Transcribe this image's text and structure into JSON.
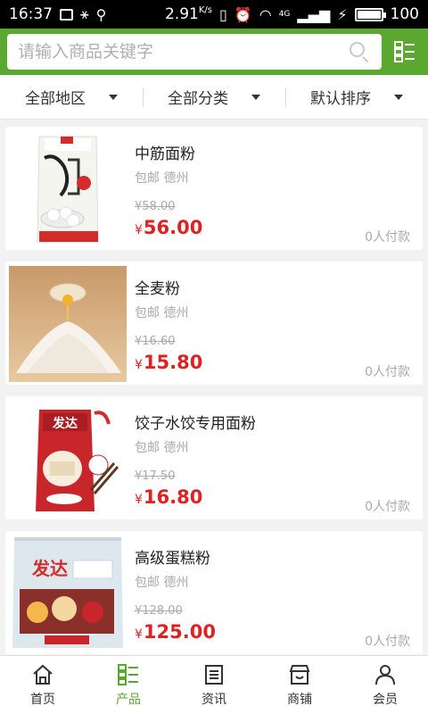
{
  "status_bar": {
    "time": "16:37",
    "speed": "2.91",
    "speed_unit": "K/s",
    "network": "4G",
    "battery": "100",
    "battery_level": 1.0
  },
  "search": {
    "placeholder": "请输入商品关键字",
    "value": ""
  },
  "filters": [
    {
      "label": "全部地区"
    },
    {
      "label": "全部分类"
    },
    {
      "label": "默认排序"
    }
  ],
  "products": [
    {
      "name": "中筋面粉",
      "tag": "包邮 德州",
      "old_price": "¥58.00",
      "currency": "¥",
      "price": "56.00",
      "paid": "0人付款",
      "image": "flour-bag-white"
    },
    {
      "name": "全麦粉",
      "tag": "包邮 德州",
      "old_price": "¥16.60",
      "currency": "¥",
      "price": "15.80",
      "paid": "0人付款",
      "image": "flour-pile-egg"
    },
    {
      "name": "饺子水饺专用面粉",
      "tag": "包邮 德州",
      "old_price": "¥17.50",
      "currency": "¥",
      "price": "16.80",
      "paid": "0人付款",
      "image": "flour-bag-red"
    },
    {
      "name": "高级蛋糕粉",
      "tag": "包邮 德州",
      "old_price": "¥128.00",
      "currency": "¥",
      "price": "125.00",
      "paid": "0人付款",
      "image": "flour-sack-blue"
    }
  ],
  "tabs": [
    {
      "label": "首页",
      "icon": "home-icon",
      "active": false
    },
    {
      "label": "产品",
      "icon": "grid-list-icon",
      "active": true
    },
    {
      "label": "资讯",
      "icon": "document-icon",
      "active": false
    },
    {
      "label": "商铺",
      "icon": "store-icon",
      "active": false
    },
    {
      "label": "会员",
      "icon": "user-icon",
      "active": false
    }
  ],
  "colors": {
    "accent": "#5ba830",
    "price": "#dd2222",
    "muted": "#aaaaaa"
  }
}
